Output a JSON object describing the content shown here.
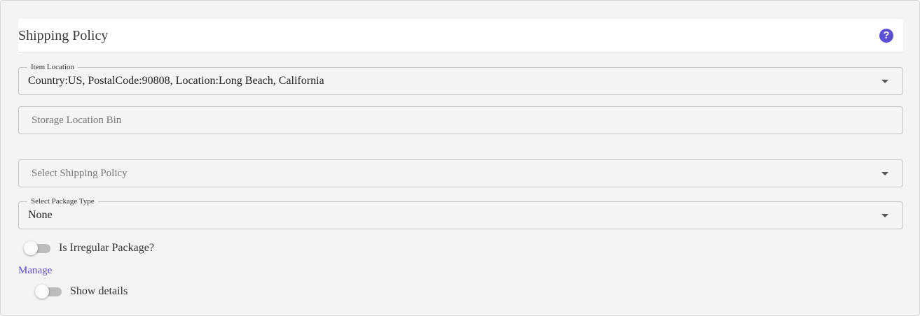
{
  "header": {
    "title": "Shipping Policy",
    "help_icon": "?"
  },
  "item_location": {
    "label": "Item Location",
    "value": "Country:US, PostalCode:90808, Location:Long Beach, California"
  },
  "storage_location_bin": {
    "placeholder": "Storage Location Bin"
  },
  "shipping_policy": {
    "placeholder": "Select Shipping Policy"
  },
  "package_type": {
    "label": "Select Package Type",
    "value": "None"
  },
  "irregular_package": {
    "label": "Is Irregular Package?",
    "checked": false
  },
  "manage_link": "Manage",
  "show_details": {
    "label": "Show details",
    "checked": false
  },
  "colors": {
    "accent": "#5b4fd6",
    "panel_bg": "#f4f4f4",
    "border": "#c4c4c4"
  }
}
